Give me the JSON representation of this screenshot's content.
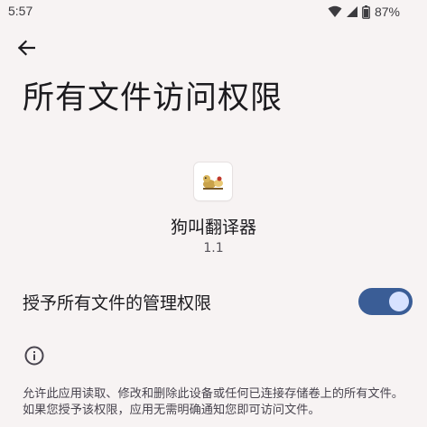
{
  "status_bar": {
    "time": "5:57",
    "battery_percent": "87%",
    "icons": [
      "wifi-icon",
      "cellular-signal-icon",
      "battery-icon"
    ]
  },
  "header": {
    "back_icon": "arrow-left-icon",
    "title": "所有文件访问权限"
  },
  "app": {
    "icon": "dog-translator-app-icon",
    "name": "狗叫翻译器",
    "version": "1.1"
  },
  "permission": {
    "label": "授予所有文件的管理权限",
    "enabled": true
  },
  "info": {
    "icon": "info-icon",
    "text": "允许此应用读取、修改和删除此设备或任何已连接存储卷上的所有文件。如果您授予该权限，应用无需明确通知您即可访问文件。"
  },
  "colors": {
    "background": "#f7f3f3",
    "switch_track_on": "#3a5d96",
    "switch_thumb_on": "#d7e2ff",
    "text_primary": "#1c1b1f",
    "text_secondary": "#49454f"
  }
}
